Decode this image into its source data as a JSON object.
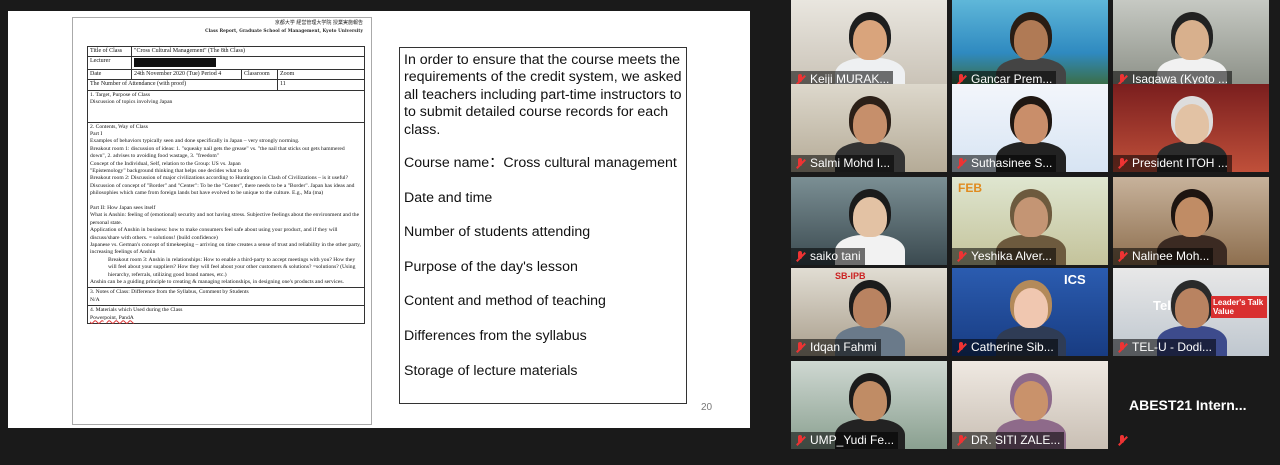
{
  "slide": {
    "doc": {
      "header_jp": "京都大学 経営管理大学院 授業実施報告",
      "header_en": "Class Report, Graduate School of Management, Kyoto University",
      "title_label": "Title of Class",
      "title_value": "\"Cross Cultural Management\" (The 8th Class)",
      "lecturer_label": "Lecturer",
      "date_label": "Date",
      "date_value": "24th November 2020 (Tue)   Period  4",
      "classroom_label": "Classroom",
      "classroom_value": "Zoom",
      "attendance_label": "The Number of Attendance (with proof)",
      "attendance_value": "11",
      "sec1_title": "1.  Target, Purpose of Class",
      "sec1_body": "Discussion of topics involving Japan",
      "sec2_title": "2.  Contents, Way of Class",
      "sec2_lines": [
        "Part I",
        "  Examples of behaviors typically seen and done specifically in Japan – very strongly norming.",
        "  Breakout room 1: discussion of ideas: 1. \"squeaky nail gets the grease\" vs. \"the nail that sticks out gets hammered down\", 2. advises to avoiding food wastage, 3. \"freedom\"",
        "Concept of the Individual, Self, relation to the Group: US vs. Japan",
        "\"Epistemology\" background thinking that helps one decides what to do",
        "  Breakout room 2: Discussion of major civilizations according to Huntington in Clash of Civilizations – is it useful?",
        "  Discussion of concept of \"Border\" and \"Center\": To be the \"Center\", there needs to be a \"Border\". Japan has ideas and philosophies which came from foreign lands but have evolved to be unique to the culture. E.g., Ma (ma)",
        "",
        "Part II: How Japan sees itself",
        "What is Anshin: feeling of (emotional) security and not having stress. Subjective feelings about the environment and the personal state.",
        "Application of Anshin in business: how to make consumers feel safe about using your product, and if they will discuss/share with others. = solutions! (build confidence)",
        "Japanese vs. German's concept of timekeeping – arriving on time creates a sense of trust and reliability in the other party, increasing feelings of Anshin"
      ],
      "sec2_indent": "Breakout room 3: Anshin in relationships: How to enable a third-party to accept meetings with you? How they will feel about your suppliers? How they will feel about your other customers & solutions? =solutions? (Using hierarchy, referrals, utilizing good brand names, etc.)",
      "sec2_tail": "Anshin can be a guiding principle to creating & managing relationships, in designing one's products and services.",
      "sec3_title": "3.  Notes of Class: Difference from the Syllabus, Comment by Students",
      "sec3_body": "N/A",
      "sec4_title": "4.  Materials which Used during the Class",
      "sec4_body": "Powerpoint, PandA"
    },
    "intro": "In order to ensure that the course meets the requirements of the credit system, we asked all teachers including part-time instructors to to submit detailed course records for each class.",
    "items": [
      "Course name：Cross cultural management",
      "Date and time",
      "Number of students attending",
      "Purpose of the day's lesson",
      "Content and method of teaching",
      "Differences from the syllabus",
      "Storage of lecture materials"
    ],
    "page_number": "20"
  },
  "participants": [
    {
      "name": "Keiji MURAK..."
    },
    {
      "name": "Gancar Prem..."
    },
    {
      "name": "Isagawa (Kyoto ..."
    },
    {
      "name": "Salmi Mohd I..."
    },
    {
      "name": "Suthasinee S..."
    },
    {
      "name": "President ITOH ..."
    },
    {
      "name": "saiko tani"
    },
    {
      "name": "Yeshika Alver..."
    },
    {
      "name": "Nalinee Moh..."
    },
    {
      "name": "Idqan Fahmi"
    },
    {
      "name": "Catherine Sib..."
    },
    {
      "name": "TEL-U - Dodi..."
    },
    {
      "name": "UMP_Yudi Fe..."
    },
    {
      "name": "DR. SITI ZALE..."
    },
    {
      "name": "ABEST21 Intern..."
    }
  ],
  "tile_texts": {
    "ics_logo": "ICS",
    "sbipb_logo": "SB-IPB",
    "feb_logo": "FEB",
    "leaders_talk": "Leader's Talk Value",
    "tel_logo": "Tel"
  },
  "colors": {
    "background": "#1a1a1a",
    "active_speaker_border": "#b6f23a",
    "muted_icon": "#e33333"
  }
}
